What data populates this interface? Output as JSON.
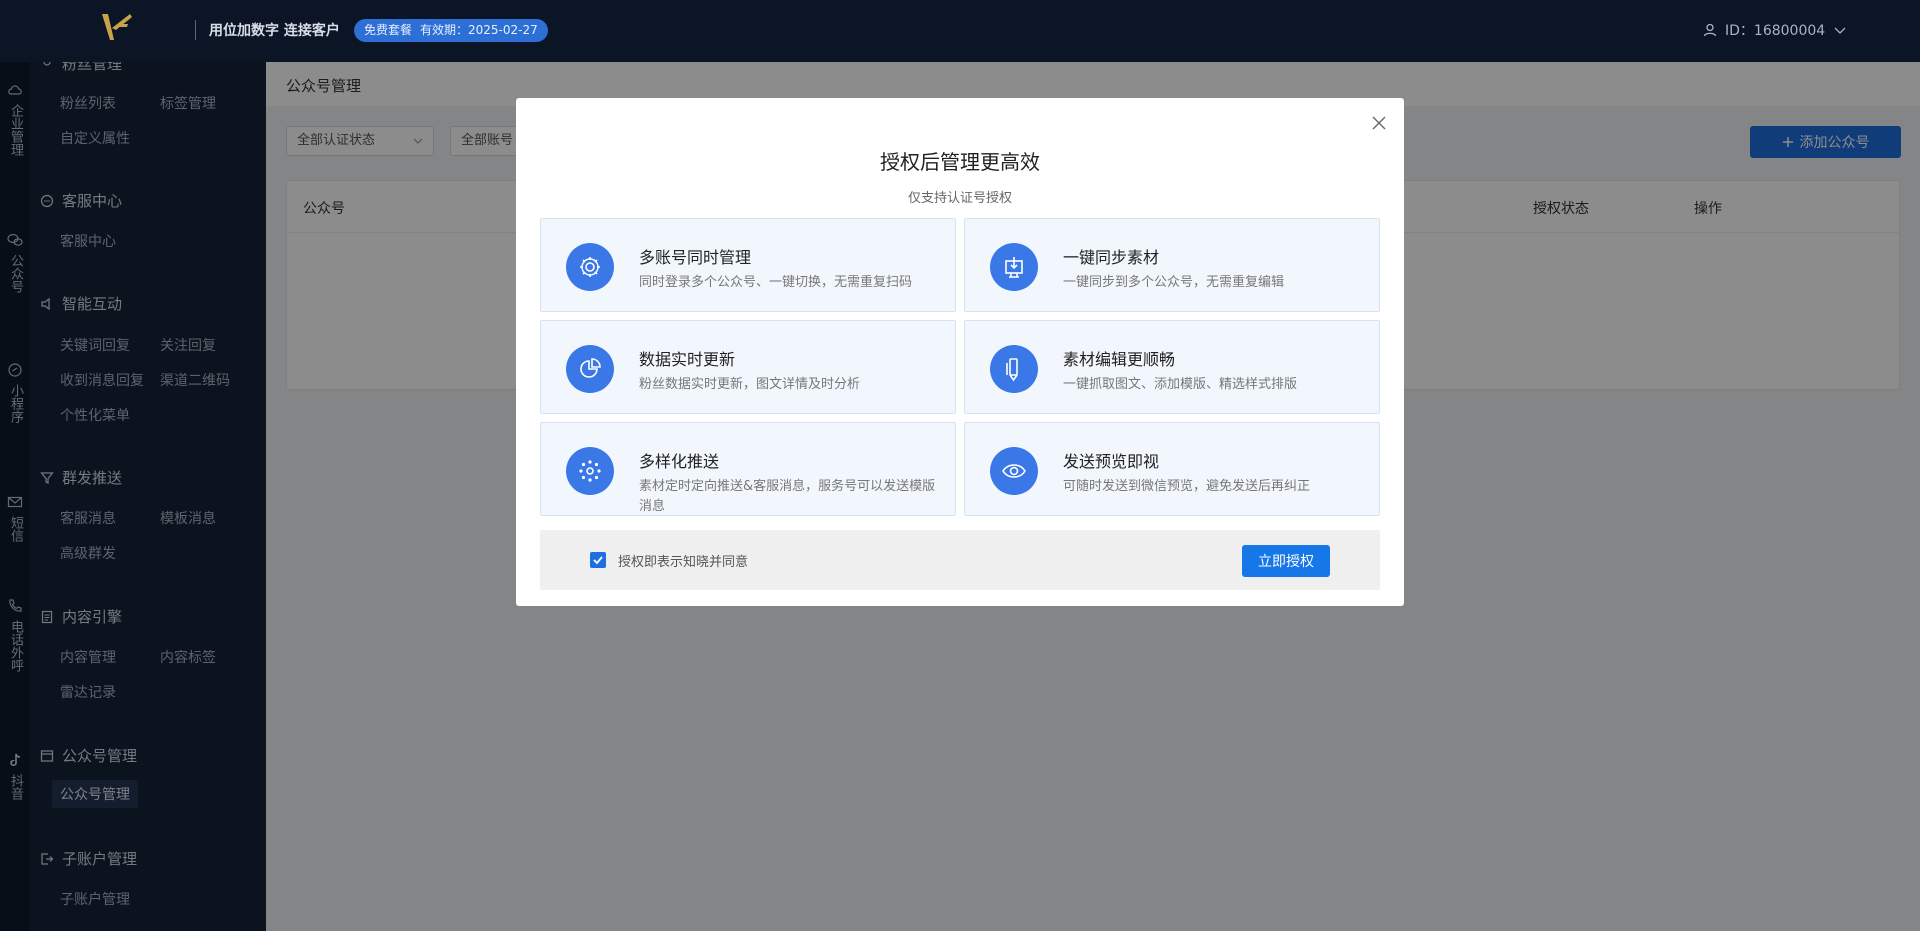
{
  "header": {
    "brand": "用位加数字 连接客户",
    "plan_name": "免费套餐",
    "plan_expiry": "有效期：2025-02-27",
    "user_id": "ID：16800004"
  },
  "rail": [
    {
      "label": "企业管理"
    },
    {
      "label": "公众号"
    },
    {
      "label": "小程序"
    },
    {
      "label": "短信"
    },
    {
      "label": "电话外呼"
    },
    {
      "label": "抖音"
    }
  ],
  "sidebar": {
    "fans_section": "粉丝管理",
    "fans_list": "粉丝列表",
    "tag_mgmt": "标签管理",
    "custom_attr": "自定义属性",
    "service_section": "客服中心",
    "service_center": "客服中心",
    "interact_section": "智能互动",
    "keyword_reply": "关键词回复",
    "follow_reply": "关注回复",
    "msg_reply": "收到消息回复",
    "channel_qr": "渠道二维码",
    "custom_menu": "个性化菜单",
    "push_section": "群发推送",
    "service_msg": "客服消息",
    "template_msg": "模板消息",
    "adv_broadcast": "高级群发",
    "content_section": "内容引擎",
    "content_mgmt": "内容管理",
    "content_tag": "内容标签",
    "radar": "雷达记录",
    "oa_section": "公众号管理",
    "oa_mgmt": "公众号管理",
    "sub_section": "子账户管理",
    "sub_mgmt": "子账户管理"
  },
  "main": {
    "breadcrumb": "公众号管理",
    "filter_auth": "全部认证状态",
    "filter_account": "全部账号",
    "add_button": "添加公众号",
    "columns": {
      "account": "公众号",
      "auth_status": "授权状态",
      "actions": "操作"
    }
  },
  "modal": {
    "title": "授权后管理更高效",
    "subtitle": "仅支持认证号授权",
    "features": [
      {
        "title": "多账号同时管理",
        "desc": "同时登录多个公众号、一键切换，无需重复扫码",
        "icon": "gear-icon"
      },
      {
        "title": "一键同步素材",
        "desc": "一键同步到多个公众号，无需重复编辑",
        "icon": "sync-icon"
      },
      {
        "title": "数据实时更新",
        "desc": "粉丝数据实时更新，图文详情及时分析",
        "icon": "pie-chart-icon"
      },
      {
        "title": "素材编辑更顺畅",
        "desc": "一键抓取图文、添加模版、精选样式排版",
        "icon": "pen-icon"
      },
      {
        "title": "多样化推送",
        "desc": "素材定时定向推送&客服消息，服务号可以发送模版消息",
        "icon": "broadcast-icon"
      },
      {
        "title": "发送预览即视",
        "desc": "可随时发送到微信预览，避免发送后再纠正",
        "icon": "eye-icon"
      }
    ],
    "agree_text": "授权即表示知晓并同意",
    "auth_button": "立即授权"
  },
  "colors": {
    "accent": "#1677e8",
    "icon_bg": "#3a78e8",
    "topbar": "#0b1526",
    "sidebar": "#14233a"
  }
}
